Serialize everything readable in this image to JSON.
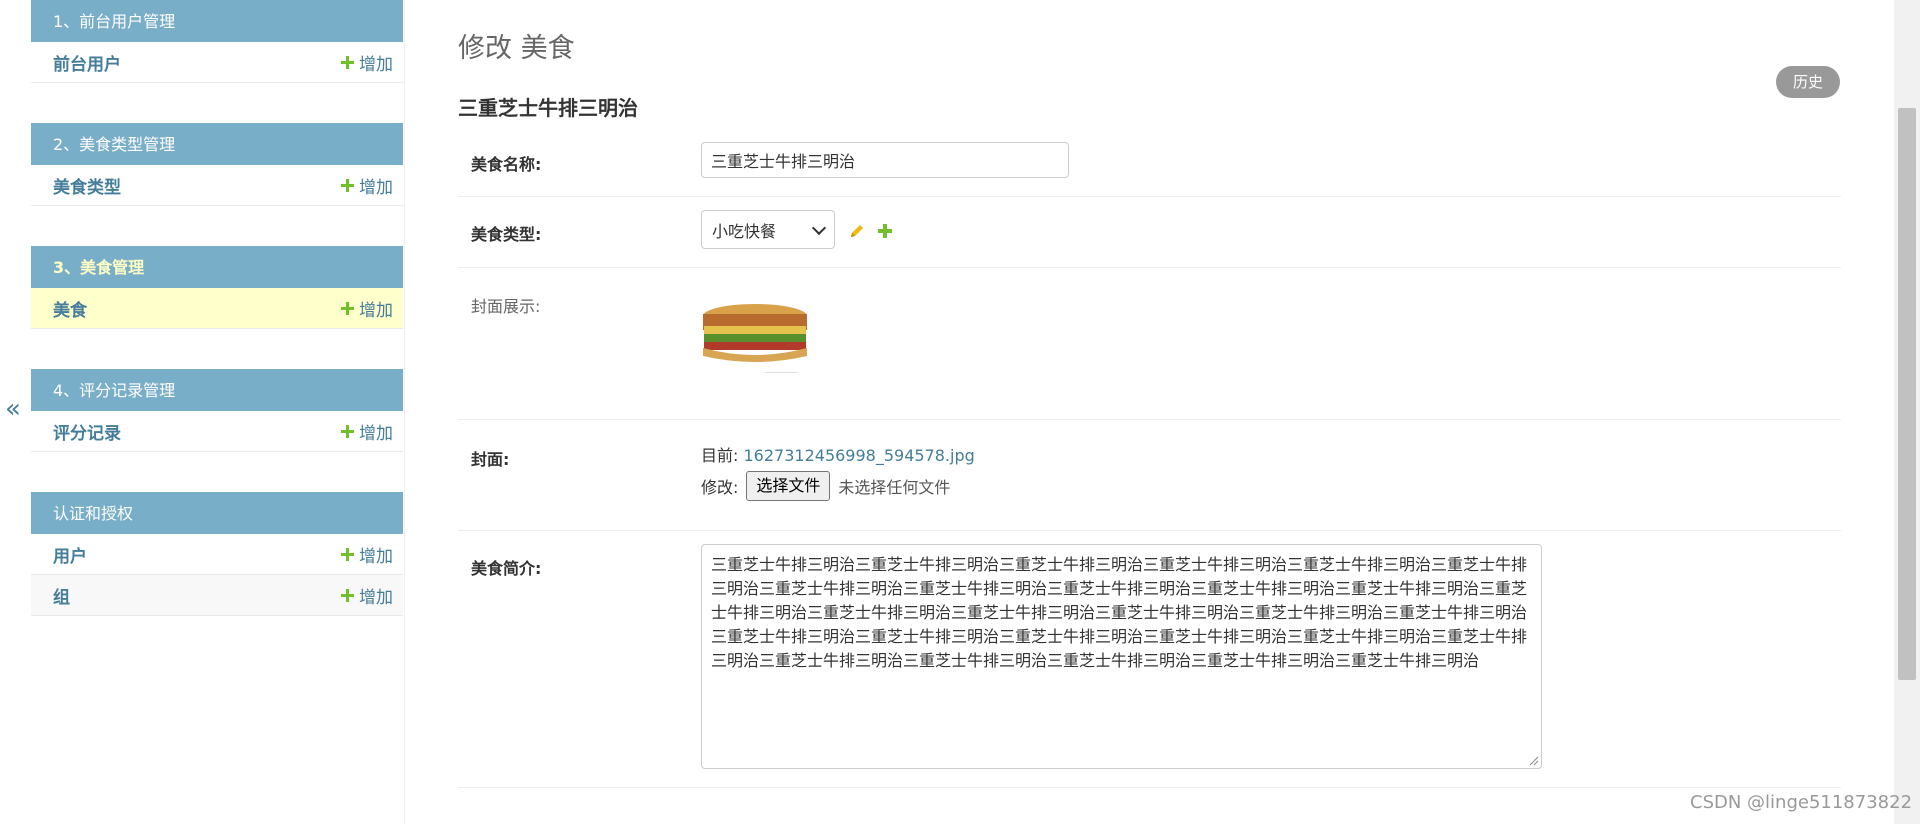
{
  "sidebar": {
    "toggle_glyph": "«",
    "modules": [
      {
        "caption": "1、前台用户管理",
        "rows": [
          {
            "label": "前台用户",
            "add": "增加"
          }
        ]
      },
      {
        "caption": "2、美食类型管理",
        "rows": [
          {
            "label": "美食类型",
            "add": "增加"
          }
        ]
      },
      {
        "caption": "3、美食管理",
        "rows": [
          {
            "label": "美食",
            "add": "增加"
          }
        ]
      },
      {
        "caption": "4、评分记录管理",
        "rows": [
          {
            "label": "评分记录",
            "add": "增加"
          }
        ]
      },
      {
        "caption": "认证和授权",
        "rows": [
          {
            "label": "用户",
            "add": "增加"
          },
          {
            "label": "组",
            "add": "增加"
          }
        ]
      }
    ]
  },
  "main": {
    "page_title": "修改 美食",
    "history_label": "历史",
    "object_title": "三重芝士牛排三明治",
    "fields": {
      "name_label": "美食名称:",
      "name_value": "三重芝士牛排三明治",
      "type_label": "美食类型:",
      "type_value": "小吃快餐",
      "cover_display_label": "封面展示:",
      "cover_label": "封面:",
      "current_prefix": "目前:",
      "current_file": "1627312456998_594578.jpg",
      "change_prefix": "修改:",
      "file_button": "选择文件",
      "file_none": "未选择任何文件",
      "intro_label": "美食简介:",
      "intro_value": "三重芝士牛排三明治三重芝士牛排三明治三重芝士牛排三明治三重芝士牛排三明治三重芝士牛排三明治三重芝士牛排三明治三重芝士牛排三明治三重芝士牛排三明治三重芝士牛排三明治三重芝士牛排三明治三重芝士牛排三明治三重芝士牛排三明治三重芝士牛排三明治三重芝士牛排三明治三重芝士牛排三明治三重芝士牛排三明治三重芝士牛排三明治三重芝士牛排三明治三重芝士牛排三明治三重芝士牛排三明治三重芝士牛排三明治三重芝士牛排三明治三重芝士牛排三明治三重芝士牛排三明治三重芝士牛排三明治三重芝士牛排三明治三重芝士牛排三明治三重芝士牛排三明治"
    }
  },
  "watermark": "CSDN @linge511873822",
  "colors": {
    "caption_bg": "#79aec8",
    "link": "#447e9b",
    "add_green": "#70bf2b",
    "selected_row": "#ffffcc"
  }
}
